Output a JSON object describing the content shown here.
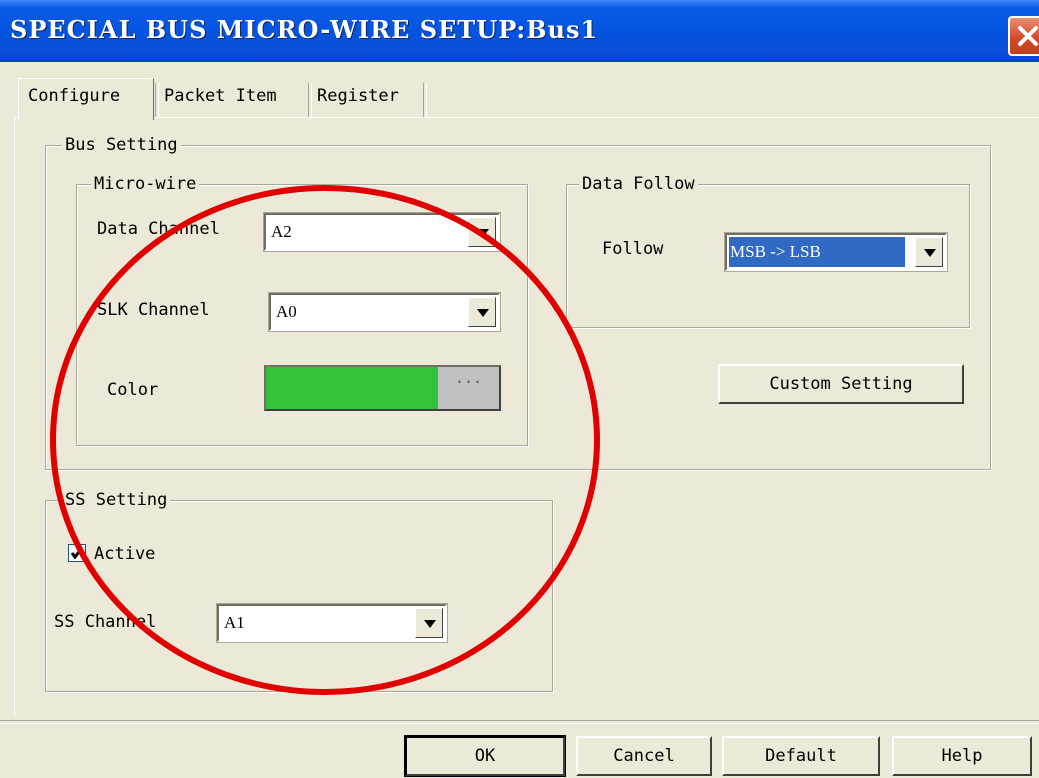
{
  "window": {
    "title": "SPECIAL BUS MICRO-WIRE SETUP:Bus1",
    "close_icon": "close-x-icon"
  },
  "tabs": [
    {
      "label": "Configure",
      "active": true
    },
    {
      "label": "Packet Item",
      "active": false
    },
    {
      "label": "Register",
      "active": false
    }
  ],
  "bus_setting": {
    "legend": "Bus Setting",
    "micro_wire": {
      "legend": "Micro-wire",
      "data_channel": {
        "label": "Data Channel",
        "value": "A2"
      },
      "slk_channel": {
        "label": "SLK Channel",
        "value": "A0"
      },
      "color": {
        "label": "Color",
        "value": "#33c33a",
        "browse_label": "···"
      }
    },
    "data_follow": {
      "legend": "Data Follow",
      "follow": {
        "label": "Follow",
        "value": "MSB -> LSB",
        "highlight": "#316ac5"
      }
    },
    "custom_setting_label": "Custom Setting"
  },
  "ss_setting": {
    "legend": "SS Setting",
    "active": {
      "label": "Active",
      "checked": true
    },
    "ss_channel": {
      "label": "SS Channel",
      "value": "A1"
    }
  },
  "footer": {
    "ok": "OK",
    "cancel": "Cancel",
    "default": "Default",
    "help": "Help"
  },
  "annotation": {
    "shape": "circle",
    "color": "#e00000"
  }
}
